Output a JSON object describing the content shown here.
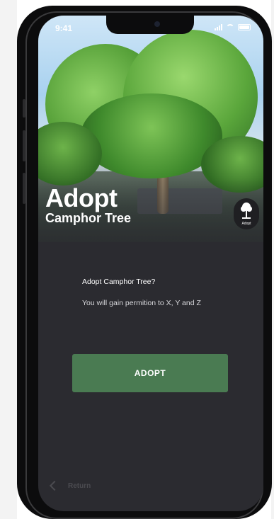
{
  "status_bar": {
    "time": "9:41"
  },
  "hero": {
    "title": "Adopt",
    "subtitle": "Camphor Tree",
    "badge_label": "Adopt"
  },
  "dialog": {
    "question": "Adopt Camphor Tree?",
    "description": "You will gain permition to X, Y and Z"
  },
  "actions": {
    "adopt_label": "ADOPT",
    "return_label": "Return"
  },
  "colors": {
    "accent_green": "#4a7b52",
    "screen_bg": "#2b2b30"
  },
  "icons": [
    "signal-icon",
    "wifi-icon",
    "battery-icon",
    "tree-logo-icon",
    "chevron-left-icon"
  ]
}
